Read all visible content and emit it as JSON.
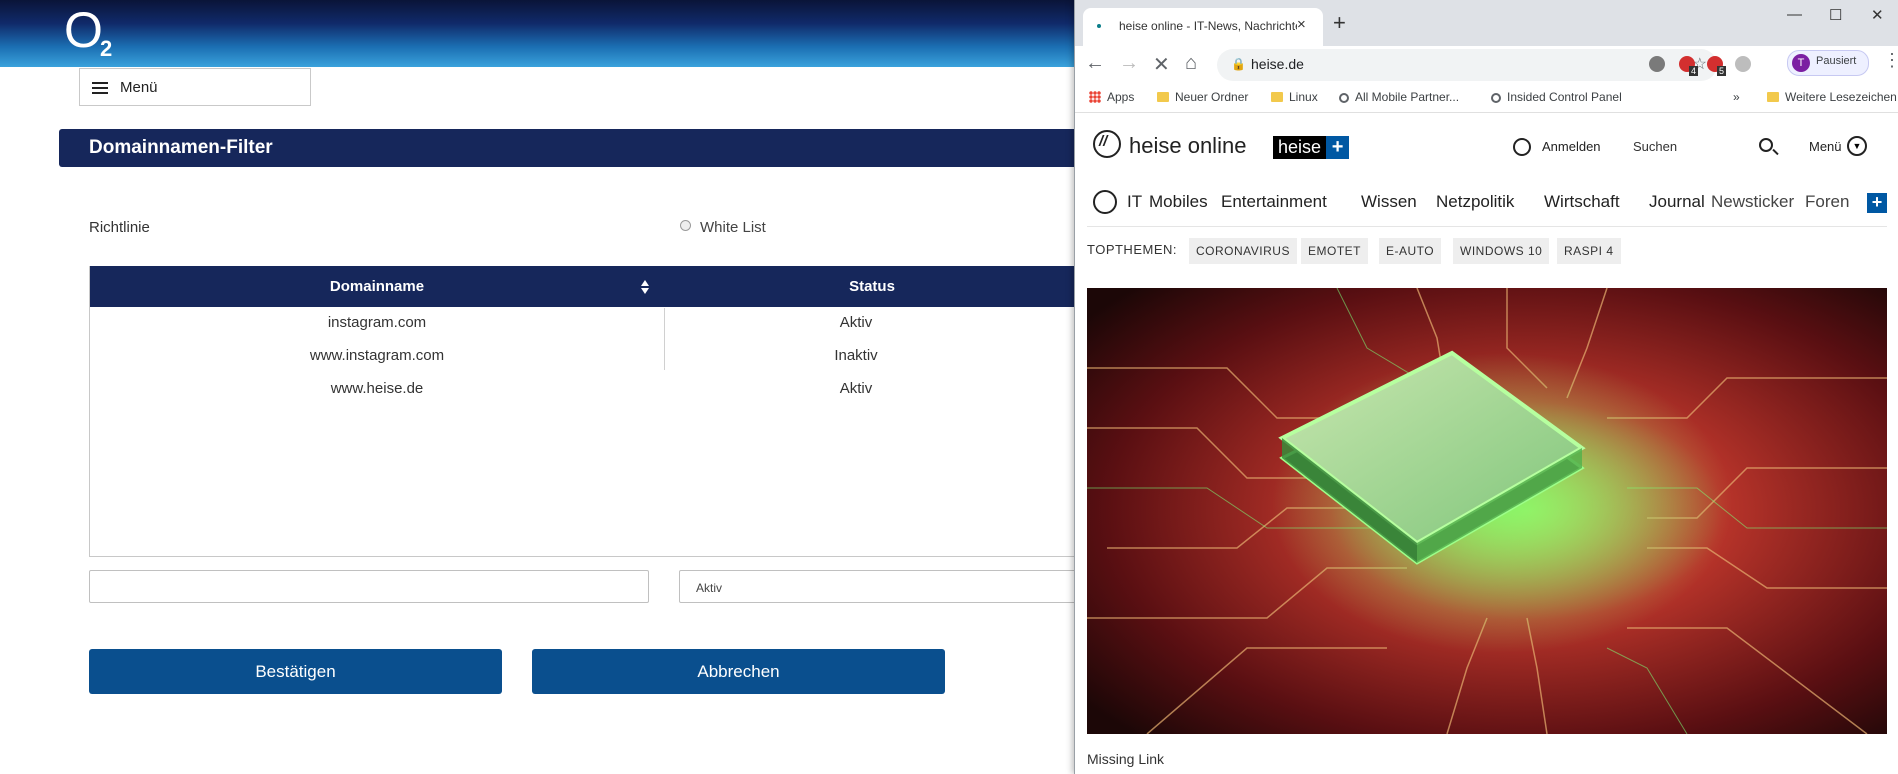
{
  "o2": {
    "logo_letter": "O",
    "logo_number": "2",
    "menu_label": "Menü",
    "page_title": "Domainnamen-Filter",
    "policy_label": "Richtlinie",
    "policy_option": "White List",
    "table": {
      "headers": [
        "Domainname",
        "Status"
      ],
      "rows": [
        {
          "domain": "instagram.com",
          "status": "Aktiv"
        },
        {
          "domain": "www.instagram.com",
          "status": "Inaktiv"
        },
        {
          "domain": "www.heise.de",
          "status": "Aktiv"
        }
      ]
    },
    "new_domain_value": "",
    "new_status_value": "Aktiv",
    "confirm_label": "Bestätigen",
    "cancel_label": "Abbrechen",
    "colors": {
      "header_navy": "#16275b",
      "button_blue": "#0a4f8e"
    }
  },
  "browser": {
    "tab_title": "heise online - IT-News, Nachrichten und Hintergründe",
    "tab_close": "×",
    "new_tab": "+",
    "window_buttons": [
      "—",
      "☐",
      "✕"
    ],
    "url": "heise.de",
    "profile_initial": "T",
    "profile_label": "Pausiert",
    "extension_badges": [
      "4",
      "5"
    ],
    "bookmarks": [
      "Apps",
      "Neuer Ordner",
      "Linux",
      "All Mobile Partner...",
      "Insided Control Panel"
    ],
    "bookmarks_more": "»",
    "other_bookmarks": "Weitere Lesezeichen"
  },
  "heise": {
    "brand": "heise online",
    "plus_brand": "heise",
    "plus_symbol": "+",
    "login_label": "Anmelden",
    "search_placeholder": "Suchen",
    "menu_label": "Menü",
    "nav": [
      "IT",
      "Mobiles",
      "Entertainment",
      "Wissen",
      "Netzpolitik",
      "Wirtschaft",
      "Journal"
    ],
    "nav_right": [
      "Newsticker",
      "Foren"
    ],
    "topthemen_label": "TOPTHEMEN:",
    "topthemen": [
      "CORONAVIRUS",
      "EMOTET",
      "E-AUTO",
      "WINDOWS 10",
      "RASPI 4"
    ],
    "hero_caption": "Missing Link"
  }
}
